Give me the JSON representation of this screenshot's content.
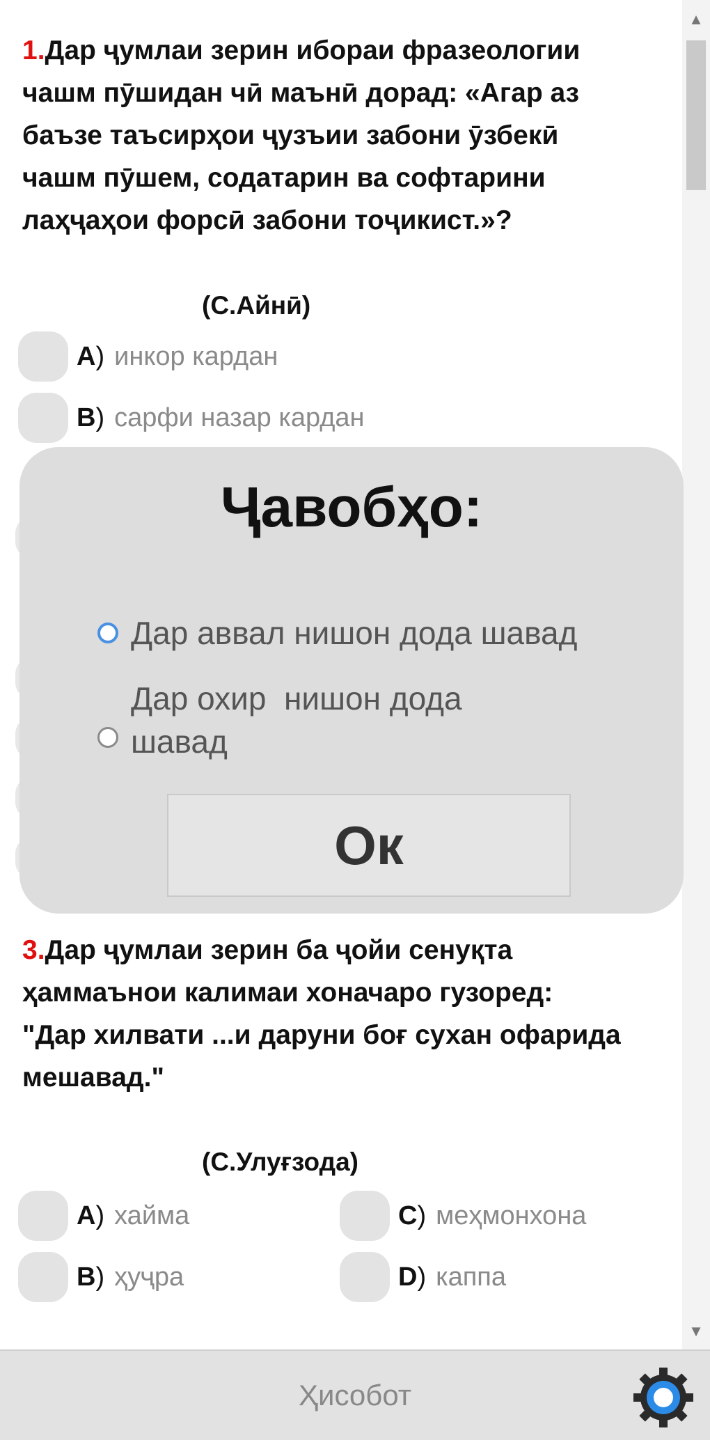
{
  "questions": [
    {
      "number": "1.",
      "text": "Дар ҷумлаи зерин ибораи фразеологии чашм пӯшидан чӣ маънӣ дорад: «Агар аз баъзе таъсирҳои ҷузъии забони ӯзбекӣ чашм пӯшем, содатарин ва софтарини лаҳҷаҳои форсӣ забони тоҷикист.»?",
      "source": "(С.Айнӣ)",
      "options": [
        {
          "letter": "A",
          "paren": ")",
          "text": "инкор кардан"
        },
        {
          "letter": "B",
          "paren": ")",
          "text": "сарфи назар кардан"
        }
      ]
    },
    {
      "number": "3.",
      "text": "Дар ҷумлаи зерин ба ҷойи сенуқта ҳаммаънои калимаи хоначаро гузоред:\n\"Дар хилвати ...и даруни боғ сухан офарида мешавад.\"",
      "source": "(С.Улуғзода)",
      "options": [
        {
          "letter": "A",
          "paren": ")",
          "text": "хайма"
        },
        {
          "letter": "C",
          "paren": ")",
          "text": "меҳмонхона"
        },
        {
          "letter": "B",
          "paren": ")",
          "text": "ҳуҷра"
        },
        {
          "letter": "D",
          "paren": ")",
          "text": "каппа"
        }
      ]
    }
  ],
  "dialog": {
    "title": "Ҷавобҳо:",
    "options": [
      {
        "label": "Дар аввал нишон дода шавад",
        "selected": true
      },
      {
        "label": "Дар охир  нишон дода шавад",
        "selected": false
      }
    ],
    "ok_label": "Ок"
  },
  "footer": {
    "report_label": "Ҳисобот",
    "settings_icon": "gear-icon"
  },
  "colors": {
    "question_number": "#e01010",
    "option_box": "#e3e3e3",
    "dialog_bg": "#dddddd",
    "radio_selected": "#4a90e2"
  }
}
